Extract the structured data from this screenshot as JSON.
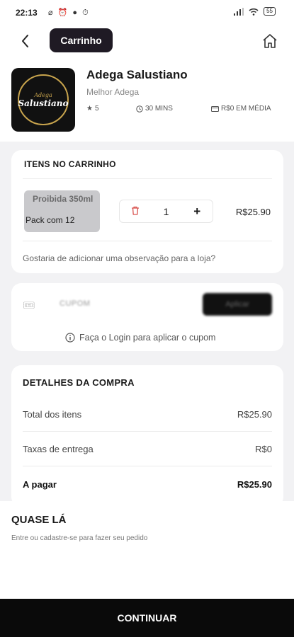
{
  "status_bar": {
    "time": "22:13",
    "battery": "55"
  },
  "header": {
    "title": "Carrinho"
  },
  "store": {
    "name": "Adega Salustiano",
    "subtitle": "Melhor Adega",
    "rating": "5",
    "delivery_time": "30 MINS",
    "average_price": "R$0 EM MÉDIA",
    "logo_top": "Adega",
    "logo_main": "Salustiano"
  },
  "cart": {
    "title": "ITENS NO CARRINHO",
    "item": {
      "name_line1": "Proibida 350ml",
      "name_line2": "Pack com 12",
      "quantity": "1",
      "minus": "",
      "plus": "+",
      "price": "R$25.90"
    },
    "observation_prompt": "Gostaria de adicionar uma observação para a loja?"
  },
  "coupon": {
    "placeholder": "CUPOM",
    "apply_label": "Aplicar",
    "login_note": "Faça o Login para aplicar o cupom"
  },
  "details": {
    "title": "DETALHES DA COMPRA",
    "rows": [
      {
        "label": "Total dos itens",
        "value": "R$25.90"
      },
      {
        "label": "Taxas de entrega",
        "value": "R$0"
      },
      {
        "label": "A pagar",
        "value": "R$25.90"
      }
    ]
  },
  "sheet": {
    "title": "QUASE LÁ",
    "subtitle": "Entre ou cadastre-se para fazer seu pedido"
  },
  "continue_label": "CONTINUAR"
}
